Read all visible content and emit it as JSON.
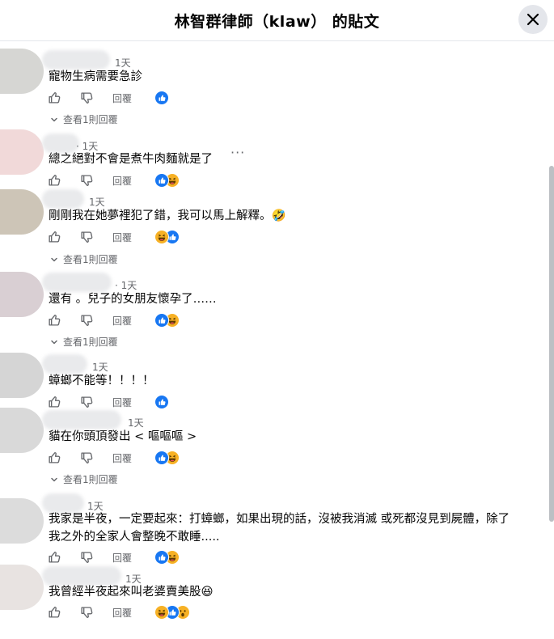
{
  "header": {
    "title": "林智群律師（klaw） 的貼文"
  },
  "labels": {
    "reply": "回覆",
    "more": "···"
  },
  "comments": [
    {
      "time": "1天",
      "text": "寵物生病需要急診",
      "view_replies": "查看1則回覆",
      "reactions": [
        "like"
      ]
    },
    {
      "time": "· 1天",
      "text": "總之絕對不會是煮牛肉麵就是了",
      "view_replies": "",
      "reactions": [
        "like",
        "haha"
      ]
    },
    {
      "time": "1天",
      "text": "剛剛我在她夢裡犯了錯，我可以馬上解釋。🤣",
      "view_replies": "查看1則回覆",
      "reactions": [
        "haha",
        "like"
      ]
    },
    {
      "time": "· 1天",
      "text": "還有 。兒子的女朋友懷孕了……",
      "view_replies": "查看1則回覆",
      "reactions": [
        "like",
        "haha"
      ]
    },
    {
      "time": "1天",
      "text": "蟑螂不能等！！！！",
      "view_replies": "",
      "reactions": [
        "like"
      ]
    },
    {
      "time": "1天",
      "text": "貓在你頭頂發出 < 嘔嘔嘔 >",
      "view_replies": "查看1則回覆",
      "reactions": [
        "like",
        "haha"
      ]
    },
    {
      "time": "1天",
      "text": "我家是半夜，一定要起來：打蟑螂，如果出現的話，沒被我消滅 或死都沒見到屍體，除了",
      "text2": "我之外的全家人會整晚不敢睡.....",
      "view_replies": "",
      "reactions": [
        "like",
        "haha"
      ]
    },
    {
      "time": "1天",
      "text": "我曾經半夜起來叫老婆賣美股😆",
      "view_replies": "",
      "reactions": [
        "haha",
        "like",
        "wow"
      ]
    }
  ]
}
